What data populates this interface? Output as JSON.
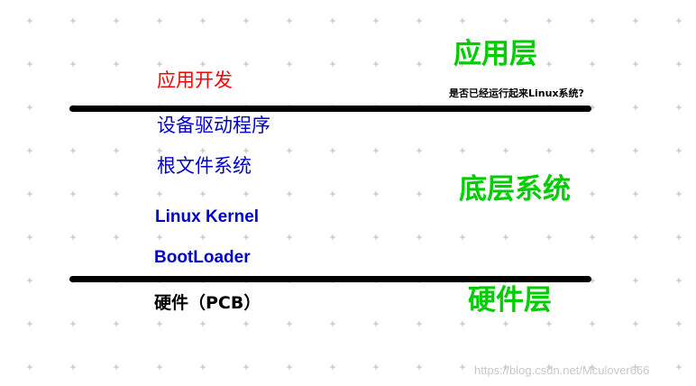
{
  "left_stack": {
    "app_dev": "应用开发",
    "device_drivers": "设备驱动程序",
    "root_fs": "根文件系统",
    "linux_kernel": "Linux Kernel",
    "bootloader": "BootLoader",
    "hardware": "硬件（PCB）"
  },
  "layers": {
    "application": "应用层",
    "base_system": "底层系统",
    "hardware": "硬件层"
  },
  "annotation": "是否已经运行起来Linux系统?",
  "watermark": "https://blog.csdn.net/Mculover666",
  "colors": {
    "app_dev": "#ff0000",
    "left_blue": "#0000cc",
    "layer_green": "#00cc00",
    "divider": "#000000",
    "grid_cross": "#b8b8b8",
    "watermark": "#c8c8c8"
  }
}
